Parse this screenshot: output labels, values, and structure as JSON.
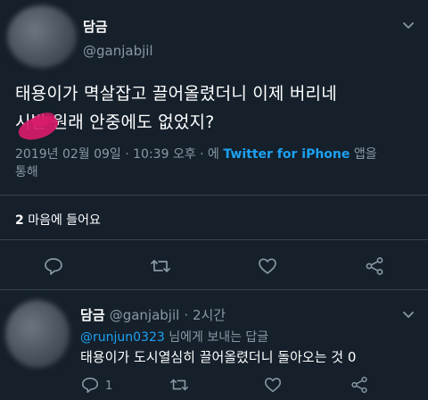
{
  "tweet": {
    "display_name": "담금",
    "handle": "@ganjabjil",
    "text_line1": "태용이가 멱살잡고 끌어올렸더니 이제 버리네",
    "text_line2": "시발 원래 안중에도 없었지?",
    "timestamp": "2019년 02월 09일 · 10:39 오후 · 에",
    "source_link": "Twitter for iPhone",
    "source_suffix": "앱을",
    "source_line2": "통해",
    "likes_count": "2",
    "likes_label": "마음에 들어요"
  },
  "reply": {
    "display_name": "담금",
    "handle": "@ganjabjil",
    "time": "· 2시간",
    "mention": "@runjun0323",
    "reply_to_suffix": "님에게 보내는 답글",
    "text": "태용이가 도시열심히 끌어올렸더니 돌아오는 것 0",
    "reply_count": "1"
  },
  "icons": [
    "chevron-down",
    "reply",
    "retweet",
    "heart",
    "share"
  ],
  "colors": {
    "background": "#15202b",
    "accent": "#1da1f2",
    "muted": "#8899a6",
    "divider": "#38444d"
  }
}
